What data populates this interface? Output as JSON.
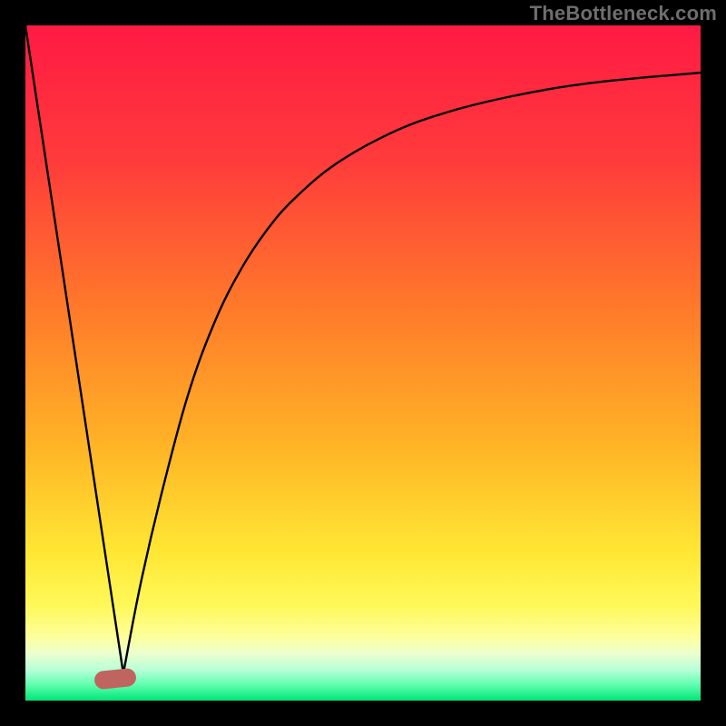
{
  "watermark": "TheBottleneck.com",
  "colors": {
    "frame": "#000000",
    "gradient_stops": [
      {
        "pos": 0.0,
        "color": "#ff1a44"
      },
      {
        "pos": 0.2,
        "color": "#ff3b3b"
      },
      {
        "pos": 0.42,
        "color": "#ff7a2a"
      },
      {
        "pos": 0.62,
        "color": "#ffb326"
      },
      {
        "pos": 0.78,
        "color": "#ffe733"
      },
      {
        "pos": 0.86,
        "color": "#fff85a"
      },
      {
        "pos": 0.905,
        "color": "#fdff9a"
      },
      {
        "pos": 0.93,
        "color": "#ecffcf"
      },
      {
        "pos": 0.955,
        "color": "#b6ffd6"
      },
      {
        "pos": 0.975,
        "color": "#66ffb3"
      },
      {
        "pos": 1.0,
        "color": "#00e676"
      }
    ],
    "curve": "#000000",
    "bump": "#c0645f"
  },
  "plot": {
    "inner_w": 744,
    "inner_h": 744,
    "margin": 28
  },
  "chart_data": {
    "type": "line",
    "title": "",
    "xlabel": "",
    "ylabel": "",
    "xlim": [
      0,
      100
    ],
    "ylim": [
      0,
      100
    ],
    "legend": false,
    "grid": false,
    "annotations": [],
    "series": [
      {
        "name": "left-slope",
        "x": [
          0,
          14.5
        ],
        "y": [
          100,
          4
        ]
      },
      {
        "name": "right-curve",
        "x": [
          14.5,
          17,
          20,
          24,
          28,
          32,
          36,
          40,
          46,
          54,
          62,
          72,
          84,
          100
        ],
        "y": [
          4,
          17,
          30,
          45,
          56,
          64,
          70,
          74.5,
          79.5,
          84,
          87,
          89.5,
          91.5,
          93
        ]
      }
    ],
    "marker": {
      "name": "min-bump",
      "x": 14.5,
      "y": 3.5
    }
  }
}
